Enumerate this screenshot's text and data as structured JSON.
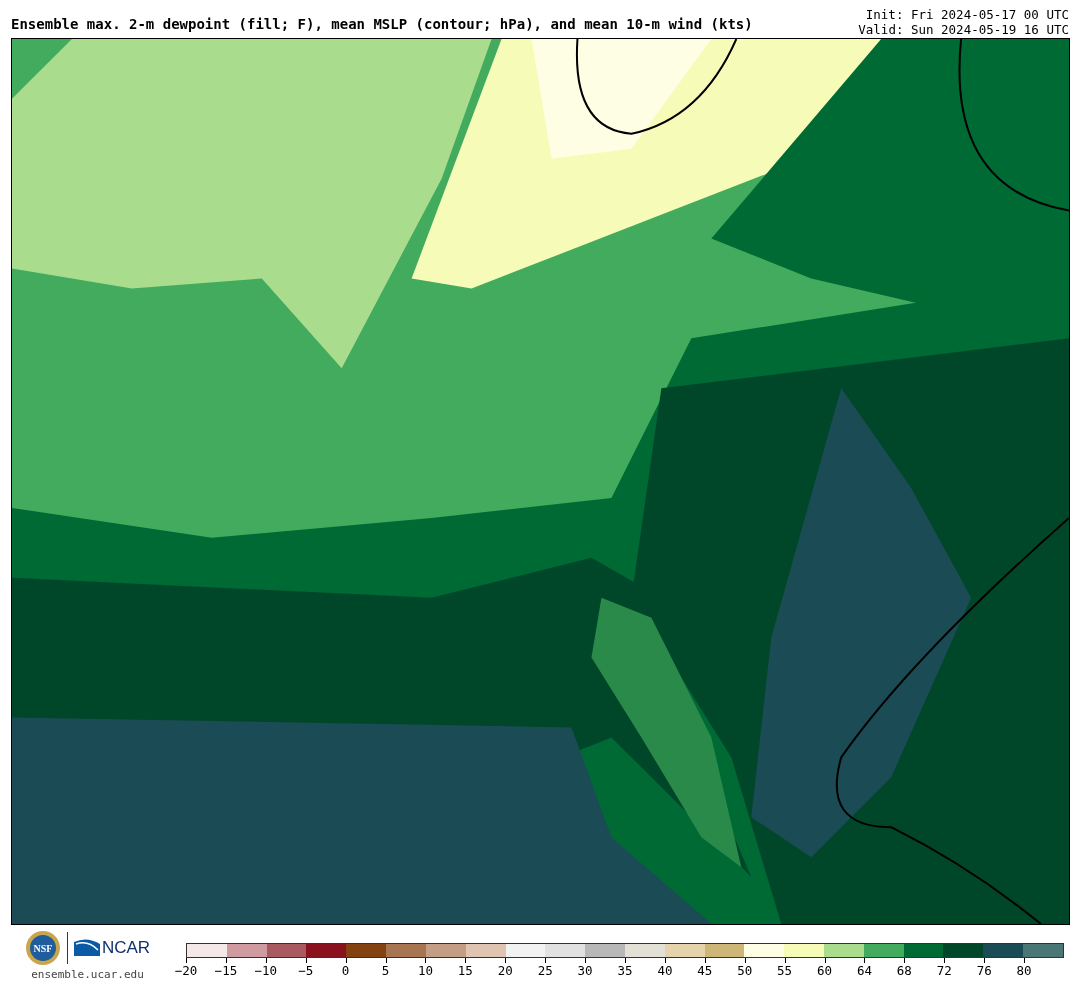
{
  "title": "Ensemble max. 2-m dewpoint (fill; F), mean MSLP (contour; hPa), and mean 10-m wind (kts)",
  "init": "Init: Fri 2024-05-17 00 UTC",
  "valid": "Valid: Sun 2024-05-19 16 UTC",
  "logos": {
    "nsf": "NSF",
    "ncar": "NCAR",
    "site": "ensemble.ucar.edu"
  },
  "colorbar": {
    "bins": [
      {
        "color": "#f5e8e8"
      },
      {
        "color": "#d09ba0"
      },
      {
        "color": "#a95a60"
      },
      {
        "color": "#8a111e"
      },
      {
        "color": "#844211"
      },
      {
        "color": "#a87552"
      },
      {
        "color": "#c49e84"
      },
      {
        "color": "#dfc4b1"
      },
      {
        "color": "#f2f2f2"
      },
      {
        "color": "#e1e1e1"
      },
      {
        "color": "#b8b8b8"
      },
      {
        "color": "#e3e1d5"
      },
      {
        "color": "#e4d3ab"
      },
      {
        "color": "#cdb778"
      },
      {
        "color": "#fefee4"
      },
      {
        "color": "#f7fbb8"
      },
      {
        "color": "#a9dd8d"
      },
      {
        "color": "#42ab5d"
      },
      {
        "color": "#006a35"
      },
      {
        "color": "#00472a"
      },
      {
        "color": "#1b4c55"
      },
      {
        "color": "#4a7775"
      }
    ],
    "ticks": [
      "−20",
      "−15",
      "−10",
      "−5",
      "0",
      "5",
      "10",
      "15",
      "20",
      "25",
      "30",
      "35",
      "40",
      "45",
      "50",
      "55",
      "60",
      "64",
      "68",
      "72",
      "76",
      "80"
    ]
  }
}
